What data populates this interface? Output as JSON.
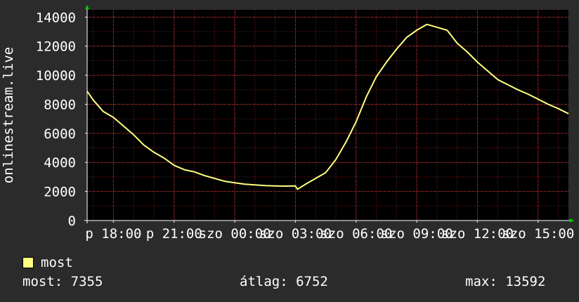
{
  "chart_data": {
    "type": "line",
    "ylabel": "onlinestream.live",
    "ylim": [
      0,
      14500
    ],
    "y_ticks": [
      0,
      2000,
      4000,
      6000,
      8000,
      10000,
      12000,
      14000
    ],
    "x_range_hours": [
      16.7,
      40.5
    ],
    "x_ticks": [
      {
        "label": "p 18:00",
        "hour": 18
      },
      {
        "label": "p 21:00",
        "hour": 21
      },
      {
        "label": "szo 00:00",
        "hour": 24
      },
      {
        "label": "szo 03:00",
        "hour": 27
      },
      {
        "label": "szo 06:00",
        "hour": 30
      },
      {
        "label": "szo 09:00",
        "hour": 33
      },
      {
        "label": "szo 12:00",
        "hour": 36
      },
      {
        "label": "szo 15:00",
        "hour": 39
      }
    ],
    "grid": true,
    "colors": {
      "background": "#000000",
      "frame": "#2b2b2b",
      "line": "#ffff80",
      "grid": "#7a2020",
      "arrow": "#00cc00"
    },
    "series": [
      {
        "name": "most",
        "x": [
          16.7,
          17.0,
          17.5,
          18.0,
          18.5,
          19.0,
          19.5,
          20.0,
          20.5,
          21.0,
          21.5,
          22.0,
          22.5,
          23.0,
          23.5,
          24.0,
          24.5,
          25.0,
          25.5,
          26.0,
          26.5,
          27.0,
          27.1,
          27.5,
          28.0,
          28.5,
          29.0,
          29.5,
          30.0,
          30.5,
          31.0,
          31.5,
          32.0,
          32.5,
          33.0,
          33.5,
          34.0,
          34.5,
          35.0,
          35.5,
          36.0,
          36.5,
          37.0,
          37.5,
          38.0,
          38.5,
          39.0,
          39.5,
          40.0,
          40.5
        ],
        "values": [
          8900,
          8300,
          7500,
          7100,
          6500,
          5900,
          5200,
          4700,
          4300,
          3800,
          3500,
          3350,
          3100,
          2900,
          2700,
          2600,
          2500,
          2450,
          2400,
          2380,
          2370,
          2380,
          2150,
          2500,
          2900,
          3300,
          4200,
          5400,
          6800,
          8500,
          9900,
          10900,
          11800,
          12600,
          13100,
          13500,
          13300,
          13100,
          12200,
          11600,
          10900,
          10300,
          9700,
          9350,
          9000,
          8700,
          8350,
          8000,
          7700,
          7355
        ]
      }
    ]
  },
  "legend": {
    "label": "most"
  },
  "stats": {
    "current": "most: 7355",
    "average": "átlag: 6752",
    "max": "max: 13592"
  }
}
